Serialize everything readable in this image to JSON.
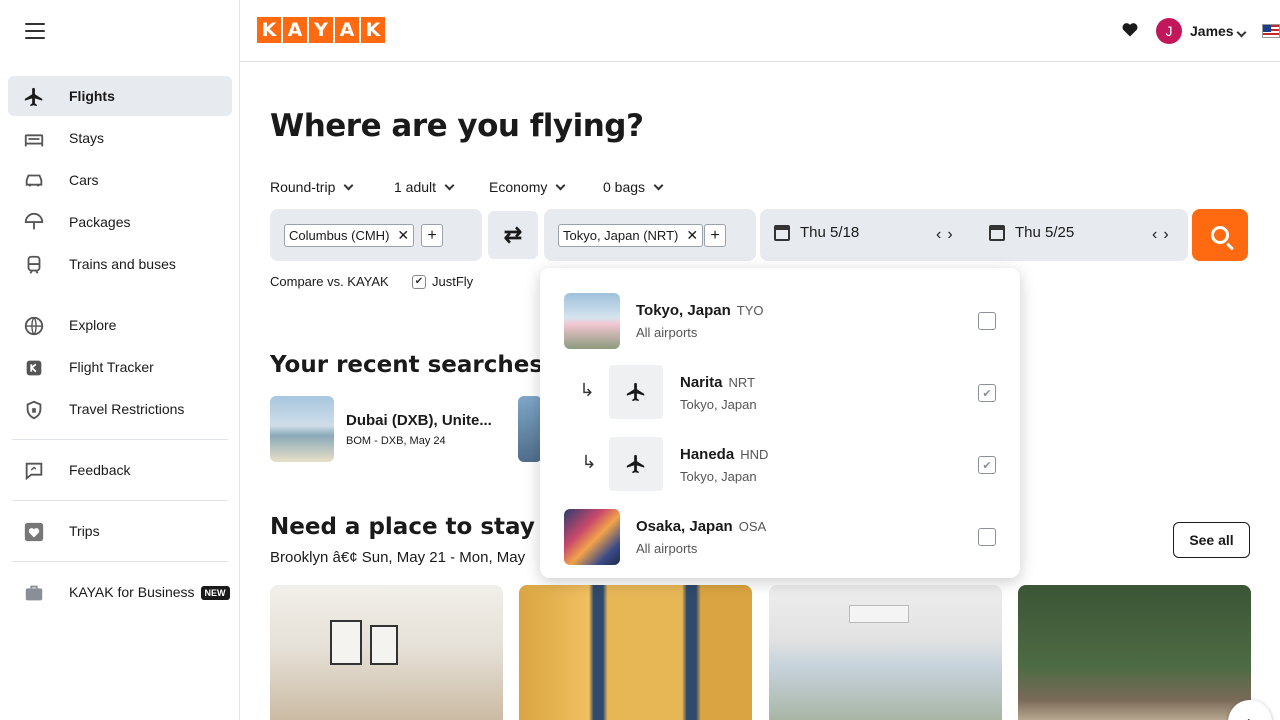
{
  "sidebar": {
    "items": [
      {
        "label": "Flights"
      },
      {
        "label": "Stays"
      },
      {
        "label": "Cars"
      },
      {
        "label": "Packages"
      },
      {
        "label": "Trains and buses"
      },
      {
        "label": "Explore"
      },
      {
        "label": "Flight Tracker"
      },
      {
        "label": "Travel Restrictions"
      },
      {
        "label": "Feedback"
      },
      {
        "label": "Trips"
      },
      {
        "label": "KAYAK for Business",
        "badge": "NEW"
      }
    ]
  },
  "header": {
    "logo_letters": [
      "K",
      "A",
      "Y",
      "A",
      "K"
    ],
    "avatar_initial": "J",
    "user_name": "James"
  },
  "search": {
    "title": "Where are you flying?",
    "trip_type": "Round-trip",
    "travelers": "1 adult",
    "cabin": "Economy",
    "bags": "0 bags",
    "origin": "Columbus (CMH)",
    "destination": "Tokyo, Japan (NRT)",
    "depart": "Thu 5/18",
    "return": "Thu 5/25",
    "compare_label": "Compare vs. KAYAK",
    "partner_label": "JustFly"
  },
  "suggestions": [
    {
      "city": "Tokyo, Japan",
      "code": "TYO",
      "sub": "All airports",
      "checked": false
    },
    {
      "city": "Narita",
      "code": "NRT",
      "sub": "Tokyo, Japan",
      "checked": true
    },
    {
      "city": "Haneda",
      "code": "HND",
      "sub": "Tokyo, Japan",
      "checked": true
    },
    {
      "city": "Osaka, Japan",
      "code": "OSA",
      "sub": "All airports",
      "checked": false
    }
  ],
  "recent": {
    "title": "Your recent searches",
    "items": [
      {
        "title": "Dubai (DXB), Unite...",
        "sub": "BOM - DXB, May 24"
      }
    ]
  },
  "stays": {
    "title": "Need a place to stay in B",
    "sub": "Brooklyn â€¢ Sun, May 21 - Mon, May",
    "see_all": "See all"
  },
  "colors": {
    "brand": "#ff690f"
  }
}
